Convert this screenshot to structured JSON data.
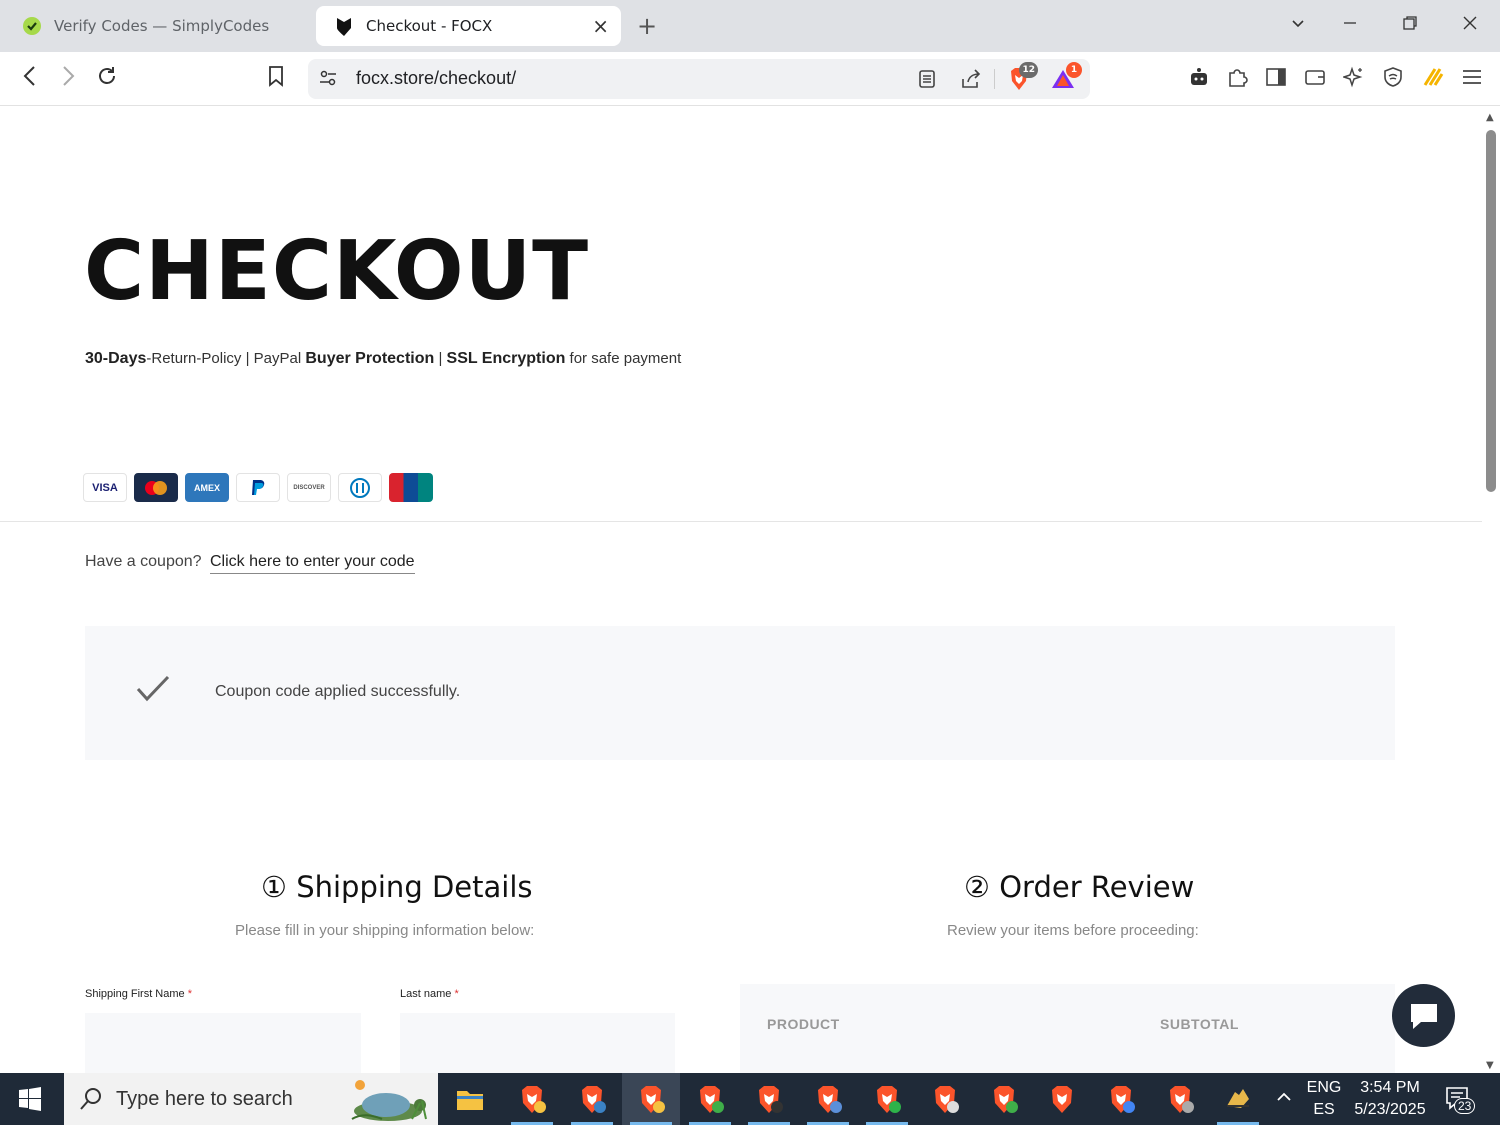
{
  "browser": {
    "tabs": [
      {
        "title": "Verify Codes — SimplyCodes",
        "active": false
      },
      {
        "title": "Checkout - FOCX",
        "active": true
      }
    ],
    "url": "focx.store/checkout/",
    "shield_badge": "12",
    "rewards_badge": "1"
  },
  "page": {
    "title": "CHECKOUT",
    "policy": {
      "p1_bold": "30-Days",
      "p1_rest": "-Return-Policy",
      "sep": "|",
      "p2_pre": "PayPal",
      "p2_bold": "Buyer Protection",
      "p3_bold": "SSL Encryption",
      "p3_rest": "for safe payment"
    },
    "payment_methods": [
      "VISA",
      "Mastercard",
      "AMEX",
      "PayPal",
      "DISCOVER",
      "Diners Club",
      "UnionPay"
    ],
    "coupon": {
      "prompt": "Have a coupon?",
      "link": "Click here to enter your code"
    },
    "notice": {
      "message": "Coupon code applied successfully."
    },
    "shipping": {
      "title": "① Shipping Details",
      "subtitle": "Please fill in your shipping information below:",
      "first_name_label": "Shipping First Name",
      "last_name_label": "Last name",
      "required_mark": "*"
    },
    "review": {
      "title": "② Order Review",
      "subtitle": "Review your items before proceeding:",
      "col_product": "PRODUCT",
      "col_subtotal": "SUBTOTAL"
    }
  },
  "taskbar": {
    "search_placeholder": "Type here to search",
    "lang_top": "ENG",
    "lang_bottom": "ES",
    "time": "3:54 PM",
    "date": "5/23/2025",
    "notifications": "23"
  },
  "colors": {
    "brave_orange": "#fb542b",
    "taskbar_bg": "#1f2a38",
    "notice_bg": "#f7f8fa",
    "chat_button": "#222c3a"
  }
}
